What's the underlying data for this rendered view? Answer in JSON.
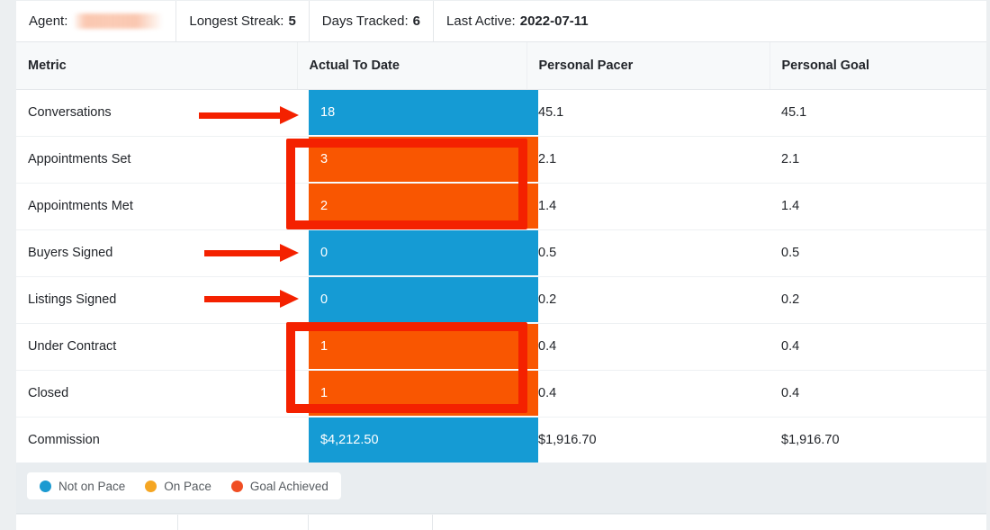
{
  "summary": {
    "agent": {
      "label": "Agent:",
      "value_redacted": true
    },
    "longest_streak": {
      "label": "Longest Streak:",
      "value": "5"
    },
    "days_tracked": {
      "label": "Days Tracked:",
      "value": "6"
    },
    "last_active": {
      "label": "Last Active:",
      "value": "2022-07-11"
    }
  },
  "table": {
    "columns": [
      "Metric",
      "Actual To Date",
      "Personal Pacer",
      "Personal Goal"
    ],
    "rows": [
      {
        "metric": "Conversations",
        "actual": "18",
        "status": "blue",
        "pacer": "45.1",
        "goal": "45.1"
      },
      {
        "metric": "Appointments Set",
        "actual": "3",
        "status": "orange",
        "pacer": "2.1",
        "goal": "2.1"
      },
      {
        "metric": "Appointments Met",
        "actual": "2",
        "status": "orange",
        "pacer": "1.4",
        "goal": "1.4"
      },
      {
        "metric": "Buyers Signed",
        "actual": "0",
        "status": "blue",
        "pacer": "0.5",
        "goal": "0.5"
      },
      {
        "metric": "Listings Signed",
        "actual": "0",
        "status": "blue",
        "pacer": "0.2",
        "goal": "0.2"
      },
      {
        "metric": "Under Contract",
        "actual": "1",
        "status": "orange",
        "pacer": "0.4",
        "goal": "0.4"
      },
      {
        "metric": "Closed",
        "actual": "1",
        "status": "orange",
        "pacer": "0.4",
        "goal": "0.4"
      },
      {
        "metric": "Commission",
        "actual": "$4,212.50",
        "status": "blue",
        "pacer": "$1,916.70",
        "goal": "$1,916.70"
      }
    ]
  },
  "legend": {
    "items": [
      {
        "label": "Not on Pace",
        "color": "#1b9ad1"
      },
      {
        "label": "On Pace",
        "color": "#f5a623"
      },
      {
        "label": "Goal Achieved",
        "color": "#f04e23"
      }
    ]
  },
  "colors": {
    "status_blue": "#159bd4",
    "status_orange": "#f95601",
    "annotation_red": "#f42100",
    "page_background": "#eceff1",
    "header_background": "#f7f9fa"
  },
  "annotations": {
    "arrows": [
      {
        "target": "Conversations",
        "direction": "right"
      },
      {
        "target": "Buyers Signed",
        "direction": "right"
      },
      {
        "target": "Listings Signed",
        "direction": "right"
      }
    ],
    "boxes": [
      {
        "targets": [
          "Appointments Set",
          "Appointments Met"
        ]
      },
      {
        "targets": [
          "Under Contract",
          "Closed"
        ]
      }
    ]
  }
}
